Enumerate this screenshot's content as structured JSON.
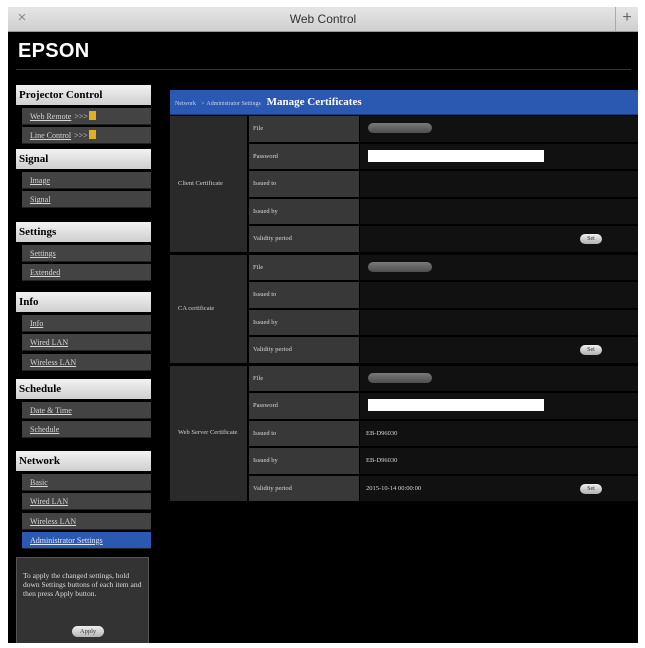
{
  "window": {
    "title": "Web Control",
    "close_glyph": "×",
    "new_tab_glyph": "+"
  },
  "brand": "EPSON",
  "sidebar": {
    "sections": [
      {
        "title": "Projector Control",
        "items": [
          {
            "label": "Web Remote",
            "suffix": ">>>"
          },
          {
            "label": "Line Control",
            "suffix": ">>>"
          }
        ]
      },
      {
        "title": "Signal",
        "items": [
          {
            "label": "Image"
          },
          {
            "label": "Signal"
          }
        ]
      },
      {
        "title": "Settings",
        "items": [
          {
            "label": "Settings"
          },
          {
            "label": "Extended"
          }
        ]
      },
      {
        "title": "Info",
        "items": [
          {
            "label": "Info"
          },
          {
            "label": "Wired LAN"
          },
          {
            "label": "Wireless LAN"
          }
        ]
      },
      {
        "title": "Schedule",
        "items": [
          {
            "label": "Date & Time"
          },
          {
            "label": "Schedule"
          }
        ]
      },
      {
        "title": "Network",
        "items": [
          {
            "label": "Basic"
          },
          {
            "label": "Wired LAN"
          },
          {
            "label": "Wireless LAN"
          },
          {
            "label": "Administrator Settings",
            "active": true
          }
        ]
      }
    ],
    "note": "To apply the changed settings, hold down Settings buttons of each item and then press Apply button.",
    "apply_label": "Apply"
  },
  "main": {
    "breadcrumb": [
      "Network",
      "Administrator Settings"
    ],
    "breadcrumb_sep": ">",
    "title": "Manage Certificates",
    "groups": [
      {
        "label": "Client Certificate",
        "rows": [
          {
            "label": "File",
            "type": "file"
          },
          {
            "label": "Password",
            "type": "password"
          },
          {
            "label": "Issued to",
            "type": "text",
            "value": ""
          },
          {
            "label": "Issued by",
            "type": "text",
            "value": ""
          },
          {
            "label": "Validity period",
            "type": "set",
            "value": "",
            "button": "Set"
          }
        ]
      },
      {
        "label": "CA certificate",
        "rows": [
          {
            "label": "File",
            "type": "file"
          },
          {
            "label": "Issued to",
            "type": "text",
            "value": ""
          },
          {
            "label": "Issued by",
            "type": "text",
            "value": ""
          },
          {
            "label": "Validity period",
            "type": "set",
            "value": "",
            "button": "Set"
          }
        ]
      },
      {
        "label": "Web Server Certificate",
        "rows": [
          {
            "label": "File",
            "type": "file"
          },
          {
            "label": "Password",
            "type": "password"
          },
          {
            "label": "Issued to",
            "type": "text",
            "value": "EB-D96030"
          },
          {
            "label": "Issued by",
            "type": "text",
            "value": "EB-D96030"
          },
          {
            "label": "Validity period",
            "type": "set",
            "value": "2015-10-14 00:00:00",
            "button": "Set"
          }
        ]
      }
    ]
  },
  "colors": {
    "accent": "#2b59b2",
    "background": "#000000",
    "row_label": "#383838",
    "group_label": "#2a2a2a"
  },
  "icons": {
    "close": "close-icon",
    "new_tab": "plus-icon",
    "popup": "popup-window-icon"
  }
}
